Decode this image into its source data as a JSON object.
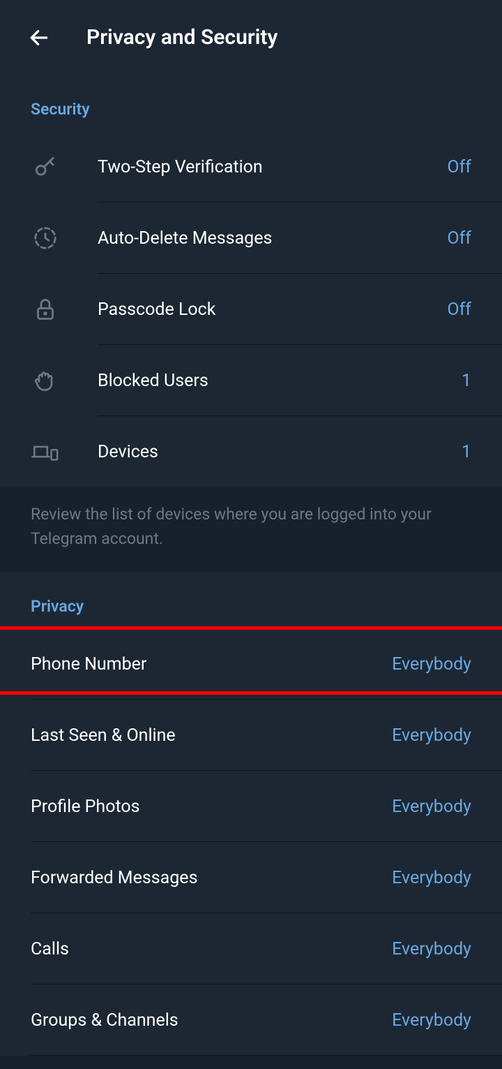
{
  "header": {
    "title": "Privacy and Security"
  },
  "security": {
    "title": "Security",
    "items": [
      {
        "label": "Two-Step Verification",
        "value": "Off"
      },
      {
        "label": "Auto-Delete Messages",
        "value": "Off"
      },
      {
        "label": "Passcode Lock",
        "value": "Off"
      },
      {
        "label": "Blocked Users",
        "value": "1"
      },
      {
        "label": "Devices",
        "value": "1"
      }
    ],
    "footer": "Review the list of devices where you are logged into your Telegram account."
  },
  "privacy": {
    "title": "Privacy",
    "items": [
      {
        "label": "Phone Number",
        "value": "Everybody",
        "highlighted": true
      },
      {
        "label": "Last Seen & Online",
        "value": "Everybody"
      },
      {
        "label": "Profile Photos",
        "value": "Everybody"
      },
      {
        "label": "Forwarded Messages",
        "value": "Everybody"
      },
      {
        "label": "Calls",
        "value": "Everybody"
      },
      {
        "label": "Groups & Channels",
        "value": "Everybody"
      }
    ]
  }
}
